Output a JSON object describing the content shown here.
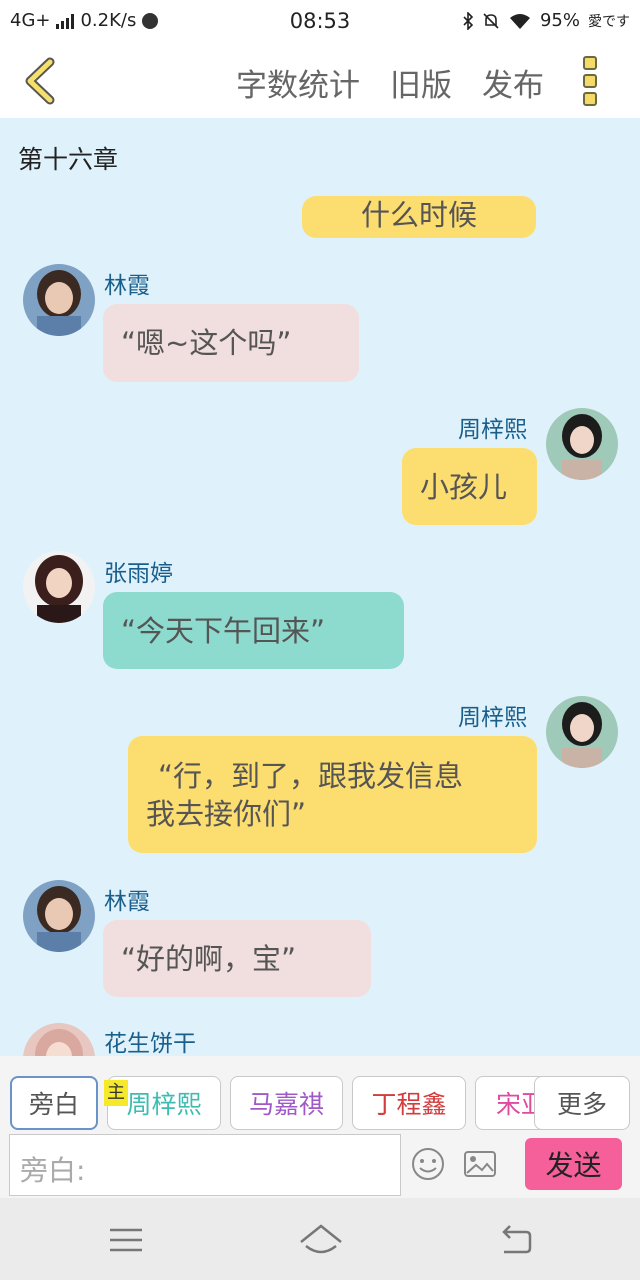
{
  "status": {
    "network": "4G+",
    "speed": "0.2K/s",
    "time": "08:53",
    "battery": "95%",
    "carrier_tag": "愛です"
  },
  "header": {
    "actions": [
      "字数统计",
      "旧版",
      "发布"
    ]
  },
  "chapter_title": "第十六章",
  "messages": [
    {
      "side": "right",
      "name": "",
      "text": "什么时候",
      "color": "#fcdd70"
    },
    {
      "side": "left",
      "name": "林霞",
      "text": "“嗯~这个吗”",
      "color": "#f1dede"
    },
    {
      "side": "right",
      "name": "周梓熙",
      "text": "小孩儿",
      "color": "#fcdd70"
    },
    {
      "side": "left",
      "name": "张雨婷",
      "text": "“今天下午回来”",
      "color": "#8ddbce"
    },
    {
      "side": "right",
      "name": "周梓熙",
      "text": "“行，到了，跟我发信息我去接你们”",
      "lines": [
        "“行，到了，跟我发信息",
        "我去接你们”"
      ],
      "color": "#fcdd70"
    },
    {
      "side": "left",
      "name": "林霞",
      "text": "“好的啊，宝”",
      "color": "#f1dede"
    },
    {
      "side": "left",
      "name": "花生饼干",
      "text": "",
      "color": "#f1dede"
    }
  ],
  "roles": [
    {
      "label": "旁白",
      "color": "#555555"
    },
    {
      "label": "周梓熙",
      "color": "#3fbcb2"
    },
    {
      "label": "马嘉祺",
      "color": "#a05ac8"
    },
    {
      "label": "丁程鑫",
      "color": "#d23c3c"
    },
    {
      "label": "宋亚",
      "color": "#e04aa0"
    }
  ],
  "main_tag": "主",
  "more_label": "更多",
  "input_placeholder": "旁白:",
  "send_label": "发送"
}
